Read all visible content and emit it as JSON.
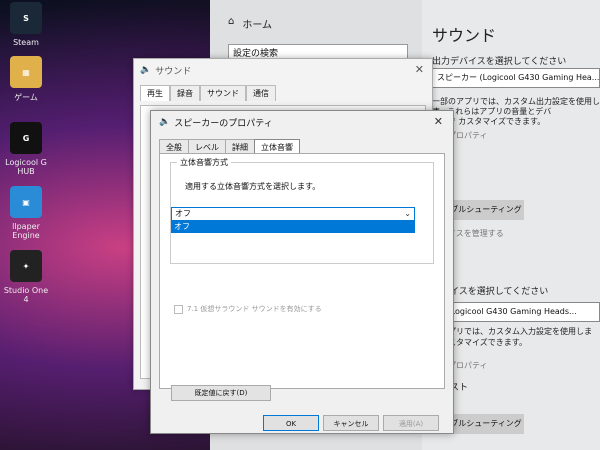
{
  "desktop": {
    "icons": [
      {
        "label": "Steam",
        "icon": "steam-icon",
        "color": "#1b2838"
      },
      {
        "label": "ゲーム",
        "icon": "folder-icon",
        "color": "#e0b04a"
      },
      {
        "label": "Logicool G HUB",
        "icon": "g-hub-icon",
        "color": "#111111"
      },
      {
        "label": "llpaper Engine",
        "icon": "wallpaper-engine-icon",
        "color": "#2a8bd6"
      },
      {
        "label": "Studio One 4",
        "icon": "studio-one-icon",
        "color": "#222222"
      }
    ]
  },
  "settings": {
    "home": "ホーム",
    "search_placeholder": "設定の検索",
    "title": "サウンド",
    "output_label": "出力デバイスを選択してください",
    "output_device": "スピーカー (Logicool G430 Gaming Hea...",
    "output_note_1": "一部のアプリでは、カスタム出力設定を使用しま",
    "output_note_2": "す。これらはアプリの音量とデバ",
    "output_note_3": "イスで カスタマイズできます。",
    "device_props_1": "スのプロパティ",
    "volume_label": "ーム",
    "troubleshoot_1": "トラブルシューティング",
    "manage_devices": "デバイスを管理する",
    "input_label": "デバイスを選択してください",
    "input_device": "ク (Logicool G430 Gaming Heads...",
    "input_note_1": "のアプリでは、カスタム入力設定を使用しま",
    "input_note_2": "でカスタマイズできます。",
    "device_props_2": "スのプロパティ",
    "test_label": "のテスト",
    "troubleshoot_2": "トラブルシューティング"
  },
  "sound_dialog": {
    "title": "サウンド",
    "tabs": [
      "再生",
      "録音",
      "サウンド",
      "通信"
    ]
  },
  "props_dialog": {
    "title": "スピーカーのプロパティ",
    "tabs": [
      "全般",
      "レベル",
      "詳細",
      "立体音響"
    ],
    "group_label": "立体音響方式",
    "description": "適用する立体音響方式を選択します。",
    "combo_value": "オフ",
    "combo_option": "オフ",
    "virtual_surround": "7.1 仮想サラウンド サウンドを有効にする",
    "reset_button": "既定値に戻す(D)",
    "ok": "OK",
    "cancel": "キャンセル",
    "apply": "適用(A)"
  }
}
